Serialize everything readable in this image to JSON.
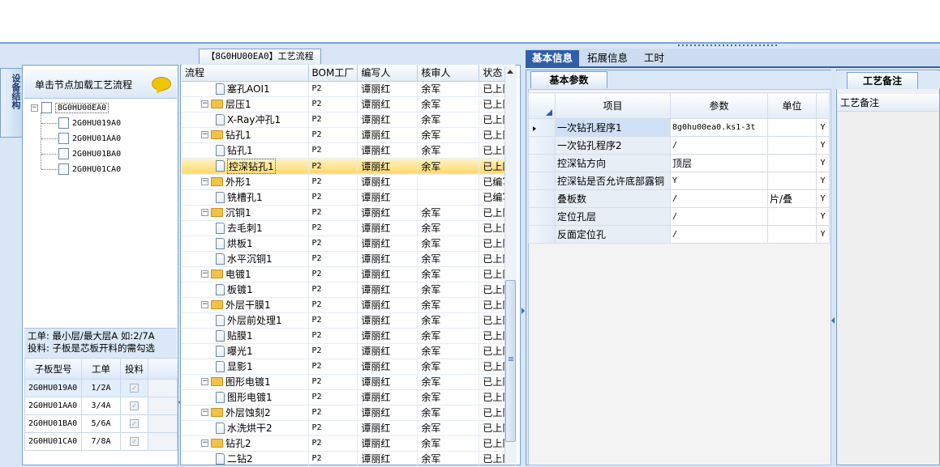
{
  "left_tab": {
    "label": "设备结构"
  },
  "left_header": {
    "label": "单击节点加载工艺流程"
  },
  "tree": {
    "root": "8G0HU00EA0",
    "children": [
      "2G0HU019A0",
      "2G0HU01AA0",
      "2G0HU01BA0",
      "2G0HU01CA0"
    ]
  },
  "info": {
    "line1": "工单: 最小层/最大层A 如:2/7A",
    "line2": "投料: 子板是芯板开料的需勾选"
  },
  "sub_grid": {
    "headers": [
      "子板型号",
      "工单",
      "投料"
    ],
    "rows": [
      {
        "model": "2G0HU019A0",
        "order": "1/2A",
        "feed": "✓"
      },
      {
        "model": "2G0HU01AA0",
        "order": "3/4A",
        "feed": "✓"
      },
      {
        "model": "2G0HU01BA0",
        "order": "5/6A",
        "feed": "✓"
      },
      {
        "model": "2G0HU01CA0",
        "order": "7/8A",
        "feed": "✓"
      }
    ]
  },
  "process": {
    "title": "【8G0HU00EA0】工艺流程",
    "headers": [
      "流程",
      "BOM工厂",
      "编写人",
      "核审人",
      "状态"
    ],
    "rows": [
      {
        "level": 2,
        "type": "file",
        "name": "塞孔AOI1",
        "bom": "P2",
        "writer": "谭丽红",
        "reviewer": "余军",
        "status": "已上冈"
      },
      {
        "level": 1,
        "type": "folder",
        "name": "层压1",
        "bom": "P2",
        "writer": "谭丽红",
        "reviewer": "余军",
        "status": "已上冈"
      },
      {
        "level": 2,
        "type": "file",
        "name": "X-Ray冲孔1",
        "bom": "P2",
        "writer": "谭丽红",
        "reviewer": "余军",
        "status": "已上冈"
      },
      {
        "level": 1,
        "type": "folder",
        "name": "钻孔1",
        "bom": "P2",
        "writer": "谭丽红",
        "reviewer": "余军",
        "status": "已上冈"
      },
      {
        "level": 2,
        "type": "file",
        "name": "钻孔1",
        "bom": "P2",
        "writer": "谭丽红",
        "reviewer": "余军",
        "status": "已上冈"
      },
      {
        "level": 2,
        "type": "file",
        "name": "控深钻孔1",
        "bom": "P2",
        "writer": "谭丽红",
        "reviewer": "余军",
        "status": "已上冈",
        "selected": true
      },
      {
        "level": 1,
        "type": "folder",
        "name": "外形1",
        "bom": "P2",
        "writer": "谭丽红",
        "reviewer": "",
        "status": "已编写"
      },
      {
        "level": 2,
        "type": "file",
        "name": "铣槽孔1",
        "bom": "P2",
        "writer": "谭丽红",
        "reviewer": "",
        "status": "已编写"
      },
      {
        "level": 1,
        "type": "folder",
        "name": "沉铜1",
        "bom": "P2",
        "writer": "谭丽红",
        "reviewer": "余军",
        "status": "已上冈"
      },
      {
        "level": 2,
        "type": "file",
        "name": "去毛刺1",
        "bom": "P2",
        "writer": "谭丽红",
        "reviewer": "余军",
        "status": "已上冈"
      },
      {
        "level": 2,
        "type": "file",
        "name": "烘板1",
        "bom": "P2",
        "writer": "谭丽红",
        "reviewer": "余军",
        "status": "已上冈"
      },
      {
        "level": 2,
        "type": "file",
        "name": "水平沉铜1",
        "bom": "P2",
        "writer": "谭丽红",
        "reviewer": "余军",
        "status": "已上冈"
      },
      {
        "level": 1,
        "type": "folder",
        "name": "电镀1",
        "bom": "P2",
        "writer": "谭丽红",
        "reviewer": "余军",
        "status": "已上冈"
      },
      {
        "level": 2,
        "type": "file",
        "name": "板镀1",
        "bom": "P2",
        "writer": "谭丽红",
        "reviewer": "余军",
        "status": "已上冈"
      },
      {
        "level": 1,
        "type": "folder",
        "name": "外层干膜1",
        "bom": "P2",
        "writer": "谭丽红",
        "reviewer": "余军",
        "status": "已上冈"
      },
      {
        "level": 2,
        "type": "file",
        "name": "外层前处理1",
        "bom": "P2",
        "writer": "谭丽红",
        "reviewer": "余军",
        "status": "已上冈"
      },
      {
        "level": 2,
        "type": "file",
        "name": "贴膜1",
        "bom": "P2",
        "writer": "谭丽红",
        "reviewer": "余军",
        "status": "已上冈"
      },
      {
        "level": 2,
        "type": "file",
        "name": "曝光1",
        "bom": "P2",
        "writer": "谭丽红",
        "reviewer": "余军",
        "status": "已上冈"
      },
      {
        "level": 2,
        "type": "file",
        "name": "显影1",
        "bom": "P2",
        "writer": "谭丽红",
        "reviewer": "余军",
        "status": "已上冈"
      },
      {
        "level": 1,
        "type": "folder",
        "name": "图形电镀1",
        "bom": "P2",
        "writer": "谭丽红",
        "reviewer": "余军",
        "status": "已上冈"
      },
      {
        "level": 2,
        "type": "file",
        "name": "图形电镀1",
        "bom": "P2",
        "writer": "谭丽红",
        "reviewer": "余军",
        "status": "已上冈"
      },
      {
        "level": 1,
        "type": "folder",
        "name": "外层蚀刻2",
        "bom": "P2",
        "writer": "谭丽红",
        "reviewer": "余军",
        "status": "已上冈"
      },
      {
        "level": 2,
        "type": "file",
        "name": "水洗烘干2",
        "bom": "P2",
        "writer": "谭丽红",
        "reviewer": "余军",
        "status": "已上冈"
      },
      {
        "level": 1,
        "type": "folder",
        "name": "钻孔2",
        "bom": "P2",
        "writer": "谭丽红",
        "reviewer": "余军",
        "status": "已上冈"
      },
      {
        "level": 2,
        "type": "file",
        "name": "二钻2",
        "bom": "P2",
        "writer": "谭丽红",
        "reviewer": "余军",
        "status": "已上冈"
      }
    ]
  },
  "right_tabs": [
    "基本信息",
    "拓展信息",
    "工时"
  ],
  "basic_params": {
    "tab": "基本参数",
    "headers": [
      "项目",
      "参数",
      "单位"
    ],
    "rows": [
      {
        "item": "一次钻孔程序1",
        "param": "8g0hu00ea0.ks1-3t",
        "unit": "",
        "flag": "Y",
        "selected": true
      },
      {
        "item": "一次钻孔程序2",
        "param": "/",
        "unit": "",
        "flag": "Y"
      },
      {
        "item": "控深钻方向",
        "param": "顶层",
        "unit": "",
        "flag": "Y"
      },
      {
        "item": "控深钻是否允许底部露铜",
        "param": "Y",
        "unit": "",
        "flag": "Y"
      },
      {
        "item": "叠板数",
        "param": "/",
        "unit": "片/叠",
        "flag": "Y"
      },
      {
        "item": "定位孔层",
        "param": "/",
        "unit": "",
        "flag": "Y"
      },
      {
        "item": "反面定位孔",
        "param": "/",
        "unit": "",
        "flag": "Y"
      }
    ]
  },
  "notes": {
    "tab": "工艺备注",
    "header": "工艺备注"
  }
}
